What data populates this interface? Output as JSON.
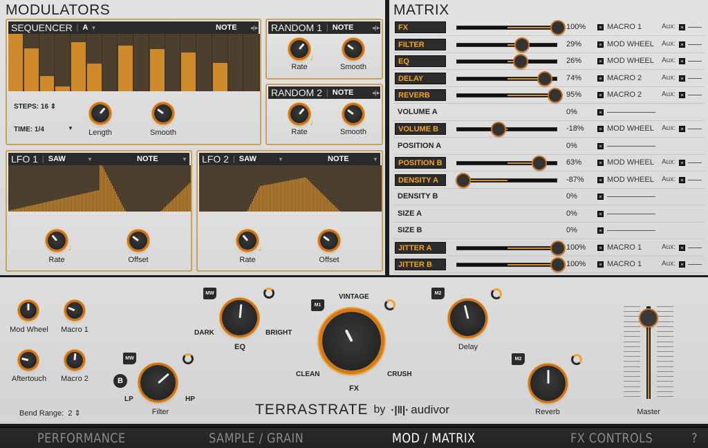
{
  "modulators": {
    "title": "MODULATORS",
    "sequencer": {
      "name": "SEQUENCER",
      "pattern": "A",
      "mode": "NOTE",
      "steps": [
        1.0,
        0.75,
        0.27,
        0.08,
        0.85,
        0.48,
        0.0,
        0.79,
        0.0,
        0.74,
        0.0,
        0.68,
        0.0,
        0.5,
        0.0,
        0.0
      ],
      "steps_label": "STEPS: 16",
      "time_label": "TIME: 1/4",
      "knobs": [
        {
          "label": "Length",
          "value": 0.65
        },
        {
          "label": "Smooth",
          "value": 0.3
        }
      ]
    },
    "random1": {
      "name": "RANDOM 1",
      "mode": "NOTE",
      "knobs": [
        {
          "label": "Rate",
          "value": 0.65
        },
        {
          "label": "Smooth",
          "value": 0.3
        }
      ]
    },
    "random2": {
      "name": "RANDOM 2",
      "mode": "NOTE",
      "knobs": [
        {
          "label": "Rate",
          "value": 0.65
        },
        {
          "label": "Smooth",
          "value": 0.3
        }
      ]
    },
    "lfo1": {
      "name": "LFO 1",
      "shape": "SAW",
      "mode": "NOTE",
      "knobs": [
        {
          "label": "Rate",
          "value": 0.35
        },
        {
          "label": "Offset",
          "value": 0.3
        }
      ]
    },
    "lfo2": {
      "name": "LFO 2",
      "shape": "SAW",
      "mode": "NOTE",
      "knobs": [
        {
          "label": "Rate",
          "value": 0.35
        },
        {
          "label": "Offset",
          "value": 0.3
        }
      ]
    }
  },
  "matrix": {
    "title": "MATRIX",
    "aux_label": "Aux:",
    "rows": [
      {
        "label": "FX",
        "active": true,
        "value": 100,
        "value_text": "100%",
        "source": "MACRO 1"
      },
      {
        "label": "FILTER",
        "active": true,
        "value": 29,
        "value_text": "29%",
        "source": "MOD WHEEL"
      },
      {
        "label": "EQ",
        "active": true,
        "value": 26,
        "value_text": "26%",
        "source": "MOD WHEEL"
      },
      {
        "label": "DELAY",
        "active": true,
        "value": 74,
        "value_text": "74%",
        "source": "MACRO 2"
      },
      {
        "label": "REVERB",
        "active": true,
        "value": 95,
        "value_text": "95%",
        "source": "MACRO 2"
      },
      {
        "label": "VOLUME A",
        "active": false,
        "value": 0,
        "value_text": "0%",
        "source": ""
      },
      {
        "label": "VOLUME B",
        "active": true,
        "value": -18,
        "value_text": "-18%",
        "source": "MOD WHEEL"
      },
      {
        "label": "POSITION A",
        "active": false,
        "value": 0,
        "value_text": "0%",
        "source": ""
      },
      {
        "label": "POSITION B",
        "active": true,
        "value": 63,
        "value_text": "63%",
        "source": "MOD WHEEL"
      },
      {
        "label": "DENSITY A",
        "active": true,
        "value": -87,
        "value_text": "-87%",
        "source": "MOD WHEEL"
      },
      {
        "label": "DENSITY B",
        "active": false,
        "value": 0,
        "value_text": "0%",
        "source": ""
      },
      {
        "label": "SIZE A",
        "active": false,
        "value": 0,
        "value_text": "0%",
        "source": ""
      },
      {
        "label": "SIZE B",
        "active": false,
        "value": 0,
        "value_text": "0%",
        "source": ""
      },
      {
        "label": "JITTER A",
        "active": true,
        "value": 100,
        "value_text": "100%",
        "source": "MACRO 1"
      },
      {
        "label": "JITTER B",
        "active": true,
        "value": 100,
        "value_text": "100%",
        "source": "MACRO 1"
      }
    ]
  },
  "performance": {
    "small_knobs": [
      {
        "label": "Mod Wheel",
        "value": 0.5
      },
      {
        "label": "Macro 1",
        "value": 0.25
      },
      {
        "label": "Aftertouch",
        "value": 0.22
      },
      {
        "label": "Macro 2",
        "value": 0.52
      }
    ],
    "bend_range_label": "Bend Range:",
    "bend_range_value": "2",
    "filter": {
      "label": "Filter",
      "badge": "MW",
      "bypass": "B",
      "left": "LP",
      "right": "HP",
      "value": 0.68
    },
    "eq": {
      "label": "EQ",
      "badge": "MW",
      "left": "DARK",
      "right": "BRIGHT",
      "value": 0.52
    },
    "fx": {
      "label": "FX",
      "badge": "M1",
      "top": "VINTAGE",
      "left": "CLEAN",
      "right": "CRUSH",
      "value": 0.4
    },
    "delay": {
      "label": "Delay",
      "badge": "M2",
      "value": 0.45
    },
    "reverb": {
      "label": "Reverb",
      "badge": "M2",
      "value": 0.5
    },
    "master": {
      "label": "Master",
      "value": 0.87
    },
    "brand": {
      "product": "TERRASTRATE",
      "by": "by",
      "company": "audivor"
    }
  },
  "tabs": [
    {
      "label": "PERFORMANCE",
      "active": false
    },
    {
      "label": "SAMPLE / GRAIN",
      "active": false
    },
    {
      "label": "MOD / MATRIX",
      "active": true
    },
    {
      "label": "FX CONTROLS",
      "active": false
    },
    {
      "label": "?",
      "active": false
    }
  ],
  "colors": {
    "accent": "#f2a42a",
    "display_bg": "#4d3f2e",
    "step_fill": "#cf8a2c"
  }
}
